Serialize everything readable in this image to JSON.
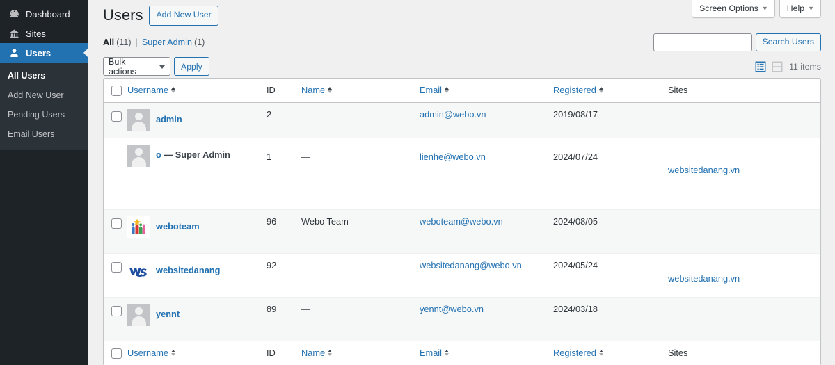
{
  "sidebar": {
    "items": [
      {
        "label": "Dashboard",
        "icon": "dashboard-icon",
        "current": false
      },
      {
        "label": "Sites",
        "icon": "sites-icon",
        "current": false
      },
      {
        "label": "Users",
        "icon": "users-icon",
        "current": true
      }
    ],
    "submenu": [
      {
        "label": "All Users",
        "current": true
      },
      {
        "label": "Add New User",
        "current": false
      },
      {
        "label": "Pending Users",
        "current": false
      },
      {
        "label": "Email Users",
        "current": false
      }
    ]
  },
  "screen_meta": {
    "screen_options": "Screen Options",
    "help": "Help",
    "caret": "▼"
  },
  "header": {
    "title": "Users",
    "add_new_label": "Add New User"
  },
  "filters": {
    "all_label": "All",
    "all_count": "(11)",
    "separator": "|",
    "super_admin_label": "Super Admin",
    "super_admin_count": "(1)"
  },
  "search": {
    "value": "",
    "placeholder": "",
    "submit_label": "Search Users"
  },
  "tablenav": {
    "bulk_actions_label": "Bulk actions",
    "apply_label": "Apply",
    "list_view_icon": "list-view-icon",
    "excerpt_view_icon": "excerpt-view-icon",
    "items_count": "11 items"
  },
  "table": {
    "columns": [
      {
        "key": "cb",
        "label": "",
        "sortable": false
      },
      {
        "key": "username",
        "label": "Username",
        "sortable": true
      },
      {
        "key": "id",
        "label": "ID",
        "sortable": false
      },
      {
        "key": "name",
        "label": "Name",
        "sortable": true
      },
      {
        "key": "email",
        "label": "Email",
        "sortable": true
      },
      {
        "key": "reg",
        "label": "Registered",
        "sortable": true
      },
      {
        "key": "sites",
        "label": "Sites",
        "sortable": false
      }
    ],
    "rows": [
      {
        "checkbox": true,
        "avatar": "mystery-person-avatar",
        "username": "admin",
        "role_suffix": "",
        "id": "2",
        "name": "—",
        "email": "admin@webo.vn",
        "registered": "2019/08/17",
        "sites": []
      },
      {
        "checkbox": false,
        "avatar": "mystery-person-avatar",
        "username": "o",
        "role_suffix": "— Super Admin",
        "id": "1",
        "name": "—",
        "email": "lienhe@webo.vn",
        "registered": "2024/07/24",
        "sites": [
          "websitedanang.vn"
        ]
      },
      {
        "checkbox": true,
        "avatar": "team-group-avatar",
        "username": "weboteam",
        "role_suffix": "",
        "id": "96",
        "name": "Webo Team",
        "email": "weboteam@webo.vn",
        "registered": "2024/08/05",
        "sites": []
      },
      {
        "checkbox": true,
        "avatar": "ws-logo-avatar",
        "username": "websitedanang",
        "role_suffix": "",
        "id": "92",
        "name": "—",
        "email": "websitedanang@webo.vn",
        "registered": "2024/05/24",
        "sites": [
          "websitedanang.vn"
        ]
      },
      {
        "checkbox": true,
        "avatar": "mystery-person-avatar",
        "username": "yennt",
        "role_suffix": "",
        "id": "89",
        "name": "—",
        "email": "yennt@webo.vn",
        "registered": "2024/03/18",
        "sites": []
      }
    ]
  },
  "colors": {
    "admin_dark": "#1d2327",
    "admin_submenu": "#2c3338",
    "accent_blue": "#2271b1",
    "page_bg": "#f0f0f1",
    "link": "#2271b1",
    "border": "#c3c4c7"
  }
}
